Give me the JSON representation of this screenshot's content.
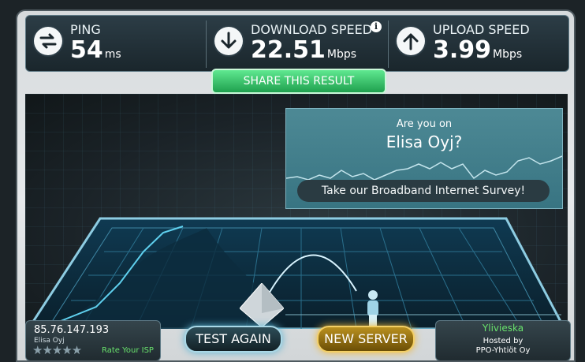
{
  "stats": {
    "ping": {
      "label": "PING",
      "value": "54",
      "unit": "ms"
    },
    "download": {
      "label": "DOWNLOAD SPEED",
      "value": "22.51",
      "unit": "Mbps",
      "info_icon": "i"
    },
    "upload": {
      "label": "UPLOAD SPEED",
      "value": "3.99",
      "unit": "Mbps"
    }
  },
  "share_label": "SHARE THIS RESULT",
  "survey": {
    "line1": "Are you on",
    "line2": "Elisa Oyj?",
    "cta": "Take our Broadband Internet Survey!"
  },
  "client": {
    "ip": "85.76.147.193",
    "isp": "Elisa Oyj",
    "stars": "★★★★★",
    "rate_label": "Rate Your ISP"
  },
  "buttons": {
    "test_again": "TEST AGAIN",
    "new_server": "NEW SERVER"
  },
  "server": {
    "city": "Ylivieska",
    "hosted_line1": "Hosted by",
    "hosted_line2": "PPO-Yhtiöt Oy"
  },
  "colors": {
    "accent_green": "#1fa04e",
    "accent_gold": "#f3cf66",
    "panel_teal": "#387482"
  },
  "icons": {
    "ping": "swap-arrows-icon",
    "download": "down-arrow-icon",
    "upload": "up-arrow-icon"
  }
}
